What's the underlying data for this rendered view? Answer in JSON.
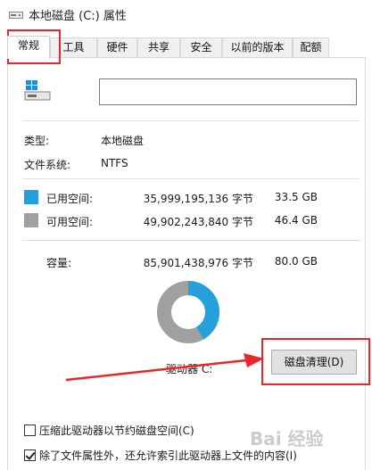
{
  "window": {
    "title": "本地磁盘 (C:) 属性"
  },
  "tabs": [
    {
      "label": "常规",
      "active": true
    },
    {
      "label": "工具",
      "active": false
    },
    {
      "label": "硬件",
      "active": false
    },
    {
      "label": "共享",
      "active": false
    },
    {
      "label": "安全",
      "active": false
    },
    {
      "label": "以前的版本",
      "active": false
    },
    {
      "label": "配额",
      "active": false
    }
  ],
  "general": {
    "name_value": "",
    "type_label": "类型:",
    "type_value": "本地磁盘",
    "fs_label": "文件系统:",
    "fs_value": "NTFS",
    "used_label": "已用空间:",
    "used_bytes": "35,999,195,136 字节",
    "used_gb": "33.5 GB",
    "free_label": "可用空间:",
    "free_bytes": "49,902,243,840 字节",
    "free_gb": "46.4 GB",
    "capacity_label": "容量:",
    "capacity_bytes": "85,901,438,976 字节",
    "capacity_gb": "80.0 GB",
    "drive_label": "驱动器 C:",
    "cleanup_button": "磁盘清理(D)",
    "compress_label": "压缩此驱动器以节约磁盘空间(C)",
    "compress_checked": false,
    "index_label": "除了文件属性外，还允许索引此驱动器上文件的内容(I)",
    "index_checked": true
  },
  "usage": {
    "used_fraction": 0.419,
    "used_color": "#26a0da",
    "free_color": "#a0a0a0"
  },
  "annotation": {
    "color": "#e8262b"
  },
  "watermark": "Bai 经验"
}
